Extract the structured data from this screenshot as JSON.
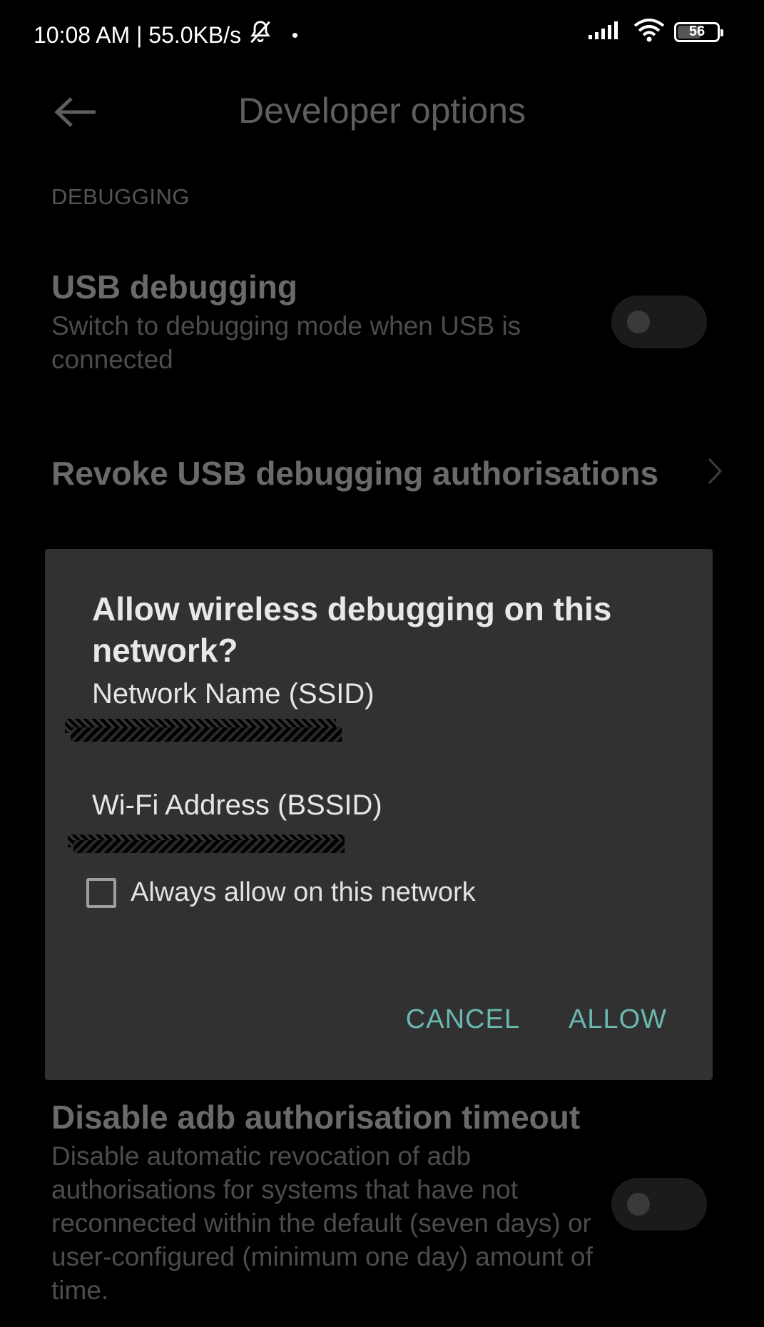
{
  "status_bar": {
    "time_speed": "10:08 AM | 55.0KB/s",
    "battery": "56",
    "icons": [
      "bell-off-icon",
      "signal-icon",
      "wifi-icon",
      "battery-icon"
    ]
  },
  "header": {
    "title": "Developer options",
    "back_icon": "back-arrow-icon"
  },
  "section": {
    "header": "DEBUGGING"
  },
  "prefs": {
    "usb_debugging": {
      "title": "USB debugging",
      "summary": "Switch to debugging mode when USB is connected",
      "enabled": false
    },
    "revoke": {
      "title": "Revoke USB debugging authorisations"
    },
    "adb_timeout": {
      "title": "Disable adb authorisation timeout",
      "summary": "Disable automatic revocation of adb authorisations for systems that have not reconnected within the default (seven days) or user-configured (minimum one day) amount of time.",
      "enabled": false
    }
  },
  "dialog": {
    "title": "Allow wireless debugging on this network?",
    "ssid_label": "Network Name (SSID)",
    "bssid_label": "Wi-Fi Address (BSSID)",
    "checkbox_label": "Always allow on this network",
    "checkbox_checked": false,
    "cancel_label": "CANCEL",
    "allow_label": "ALLOW",
    "accent_color": "#6bb8b0"
  }
}
